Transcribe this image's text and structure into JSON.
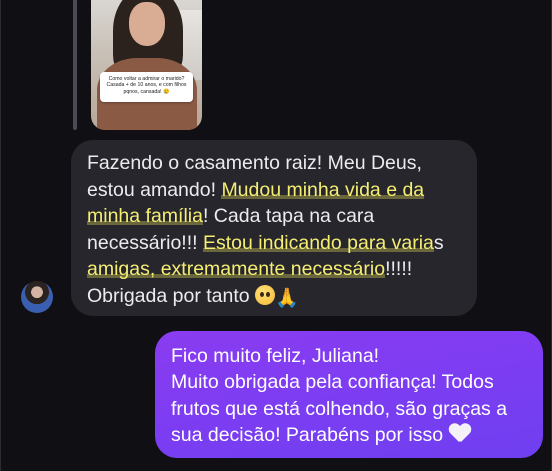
{
  "story_reply": {
    "question_lines": [
      "Como voltar a admirar o marido?",
      "Casada + de 10 anos, e com filhos",
      "pqnos, cansada! 😢"
    ]
  },
  "incoming_message": {
    "lines": [
      [
        "Fazendo o casamento raiz! Meu Deus,",
        ""
      ],
      [
        "estou amando! ",
        "Mudou minha vida e da"
      ],
      [
        "minha família",
        "! Cada tapa na cara"
      ],
      [
        "necessário!!! ",
        "Estou indicando para varia",
        "s"
      ],
      [
        "amigas, extremamente necessário",
        "!!!!!"
      ],
      [
        "Obrigada por tanto "
      ]
    ],
    "emojis": [
      "smiling-face-with-tear",
      "folded-hands"
    ],
    "highlight_color": "#f5ee72"
  },
  "outgoing_message": {
    "lines": [
      "Fico muito feliz, Juliana!",
      "Muito obrigada pela confiança! Todos",
      "frutos que está colhendo, são graças a",
      "sua decisão! Parabéns por isso "
    ],
    "emoji": "white-heart",
    "bubble_color": "#7b3df2"
  }
}
